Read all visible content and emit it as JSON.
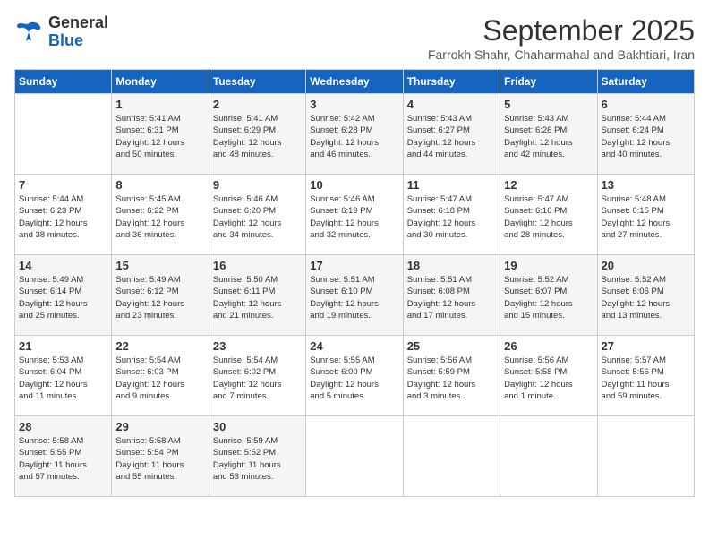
{
  "header": {
    "logo_line1": "General",
    "logo_line2": "Blue",
    "month": "September 2025",
    "location": "Farrokh Shahr, Chaharmahal and Bakhtiari, Iran"
  },
  "days_of_week": [
    "Sunday",
    "Monday",
    "Tuesday",
    "Wednesday",
    "Thursday",
    "Friday",
    "Saturday"
  ],
  "weeks": [
    [
      {
        "day": "",
        "info": ""
      },
      {
        "day": "1",
        "info": "Sunrise: 5:41 AM\nSunset: 6:31 PM\nDaylight: 12 hours\nand 50 minutes."
      },
      {
        "day": "2",
        "info": "Sunrise: 5:41 AM\nSunset: 6:29 PM\nDaylight: 12 hours\nand 48 minutes."
      },
      {
        "day": "3",
        "info": "Sunrise: 5:42 AM\nSunset: 6:28 PM\nDaylight: 12 hours\nand 46 minutes."
      },
      {
        "day": "4",
        "info": "Sunrise: 5:43 AM\nSunset: 6:27 PM\nDaylight: 12 hours\nand 44 minutes."
      },
      {
        "day": "5",
        "info": "Sunrise: 5:43 AM\nSunset: 6:26 PM\nDaylight: 12 hours\nand 42 minutes."
      },
      {
        "day": "6",
        "info": "Sunrise: 5:44 AM\nSunset: 6:24 PM\nDaylight: 12 hours\nand 40 minutes."
      }
    ],
    [
      {
        "day": "7",
        "info": "Sunrise: 5:44 AM\nSunset: 6:23 PM\nDaylight: 12 hours\nand 38 minutes."
      },
      {
        "day": "8",
        "info": "Sunrise: 5:45 AM\nSunset: 6:22 PM\nDaylight: 12 hours\nand 36 minutes."
      },
      {
        "day": "9",
        "info": "Sunrise: 5:46 AM\nSunset: 6:20 PM\nDaylight: 12 hours\nand 34 minutes."
      },
      {
        "day": "10",
        "info": "Sunrise: 5:46 AM\nSunset: 6:19 PM\nDaylight: 12 hours\nand 32 minutes."
      },
      {
        "day": "11",
        "info": "Sunrise: 5:47 AM\nSunset: 6:18 PM\nDaylight: 12 hours\nand 30 minutes."
      },
      {
        "day": "12",
        "info": "Sunrise: 5:47 AM\nSunset: 6:16 PM\nDaylight: 12 hours\nand 28 minutes."
      },
      {
        "day": "13",
        "info": "Sunrise: 5:48 AM\nSunset: 6:15 PM\nDaylight: 12 hours\nand 27 minutes."
      }
    ],
    [
      {
        "day": "14",
        "info": "Sunrise: 5:49 AM\nSunset: 6:14 PM\nDaylight: 12 hours\nand 25 minutes."
      },
      {
        "day": "15",
        "info": "Sunrise: 5:49 AM\nSunset: 6:12 PM\nDaylight: 12 hours\nand 23 minutes."
      },
      {
        "day": "16",
        "info": "Sunrise: 5:50 AM\nSunset: 6:11 PM\nDaylight: 12 hours\nand 21 minutes."
      },
      {
        "day": "17",
        "info": "Sunrise: 5:51 AM\nSunset: 6:10 PM\nDaylight: 12 hours\nand 19 minutes."
      },
      {
        "day": "18",
        "info": "Sunrise: 5:51 AM\nSunset: 6:08 PM\nDaylight: 12 hours\nand 17 minutes."
      },
      {
        "day": "19",
        "info": "Sunrise: 5:52 AM\nSunset: 6:07 PM\nDaylight: 12 hours\nand 15 minutes."
      },
      {
        "day": "20",
        "info": "Sunrise: 5:52 AM\nSunset: 6:06 PM\nDaylight: 12 hours\nand 13 minutes."
      }
    ],
    [
      {
        "day": "21",
        "info": "Sunrise: 5:53 AM\nSunset: 6:04 PM\nDaylight: 12 hours\nand 11 minutes."
      },
      {
        "day": "22",
        "info": "Sunrise: 5:54 AM\nSunset: 6:03 PM\nDaylight: 12 hours\nand 9 minutes."
      },
      {
        "day": "23",
        "info": "Sunrise: 5:54 AM\nSunset: 6:02 PM\nDaylight: 12 hours\nand 7 minutes."
      },
      {
        "day": "24",
        "info": "Sunrise: 5:55 AM\nSunset: 6:00 PM\nDaylight: 12 hours\nand 5 minutes."
      },
      {
        "day": "25",
        "info": "Sunrise: 5:56 AM\nSunset: 5:59 PM\nDaylight: 12 hours\nand 3 minutes."
      },
      {
        "day": "26",
        "info": "Sunrise: 5:56 AM\nSunset: 5:58 PM\nDaylight: 12 hours\nand 1 minute."
      },
      {
        "day": "27",
        "info": "Sunrise: 5:57 AM\nSunset: 5:56 PM\nDaylight: 11 hours\nand 59 minutes."
      }
    ],
    [
      {
        "day": "28",
        "info": "Sunrise: 5:58 AM\nSunset: 5:55 PM\nDaylight: 11 hours\nand 57 minutes."
      },
      {
        "day": "29",
        "info": "Sunrise: 5:58 AM\nSunset: 5:54 PM\nDaylight: 11 hours\nand 55 minutes."
      },
      {
        "day": "30",
        "info": "Sunrise: 5:59 AM\nSunset: 5:52 PM\nDaylight: 11 hours\nand 53 minutes."
      },
      {
        "day": "",
        "info": ""
      },
      {
        "day": "",
        "info": ""
      },
      {
        "day": "",
        "info": ""
      },
      {
        "day": "",
        "info": ""
      }
    ]
  ]
}
